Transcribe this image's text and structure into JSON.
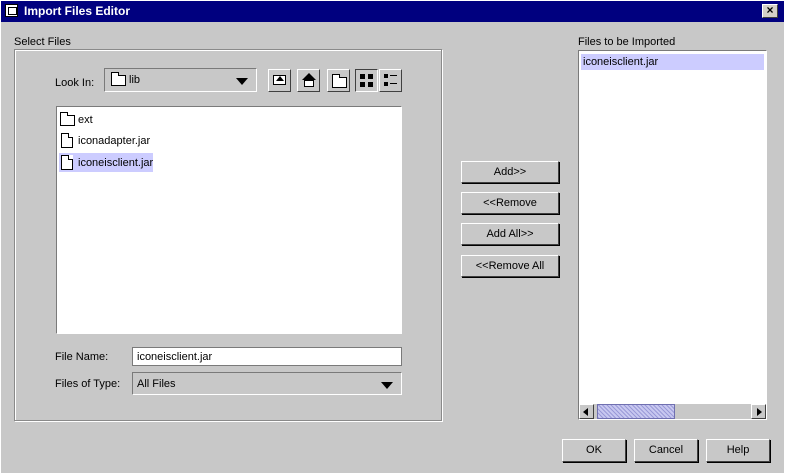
{
  "window": {
    "title": "Import Files Editor"
  },
  "select_files": {
    "group_label": "Select Files",
    "look_in_label": "Look In:",
    "look_in_value": "lib",
    "toolbar": [
      "up-one-level",
      "home",
      "new-folder",
      "list-view",
      "details-view"
    ],
    "files": [
      {
        "name": "ext",
        "type": "folder",
        "selected": false
      },
      {
        "name": "iconadapter.jar",
        "type": "file",
        "selected": false
      },
      {
        "name": "iconeisclient.jar",
        "type": "file",
        "selected": true
      }
    ],
    "file_name_label": "File Name:",
    "file_name_value": "iconeisclient.jar",
    "files_of_type_label": "Files of Type:",
    "files_of_type_value": "All Files"
  },
  "actions": {
    "add": "Add>>",
    "remove": "<<Remove",
    "add_all": "Add All>>",
    "remove_all": "<<Remove All"
  },
  "imported": {
    "label": "Files to be Imported",
    "items": [
      "iconeisclient.jar"
    ]
  },
  "footer": {
    "ok": "OK",
    "cancel": "Cancel",
    "help": "Help"
  },
  "colors": {
    "titlebar": "#00007f",
    "selection": "#ccccff",
    "background": "#c8c8c8"
  }
}
